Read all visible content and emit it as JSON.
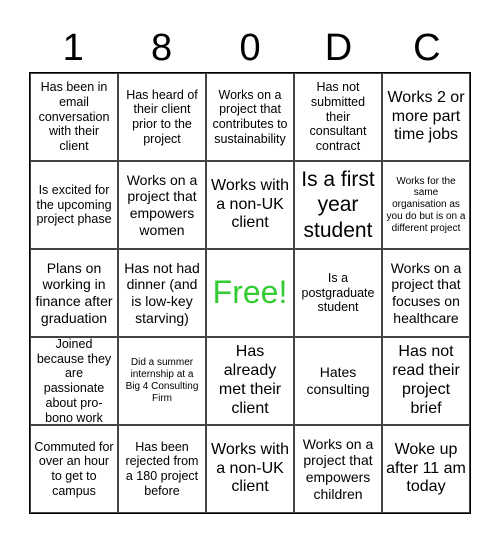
{
  "header": {
    "letters": [
      "1",
      "8",
      "0",
      "D",
      "C"
    ]
  },
  "colors": {
    "free_space": "#33cc33",
    "grid_line": "#444444",
    "text": "#000000"
  },
  "board": {
    "rows": [
      [
        {
          "text": "Has been in email conversation with their client",
          "size": "s"
        },
        {
          "text": "Has heard of their client prior to the project",
          "size": "s"
        },
        {
          "text": "Works on a project that contributes to sustainability",
          "size": "s"
        },
        {
          "text": "Has not submitted their consultant contract",
          "size": "s"
        },
        {
          "text": "Works 2 or more part time jobs",
          "size": "l"
        }
      ],
      [
        {
          "text": "Is excited for the upcoming project phase",
          "size": "s"
        },
        {
          "text": "Works on a project that empowers women",
          "size": "m"
        },
        {
          "text": "Works with a non-UK client",
          "size": "l"
        },
        {
          "text": "Is a first year student",
          "size": "xl"
        },
        {
          "text": "Works for the same organisation as you do but is on a different project",
          "size": "xs"
        }
      ],
      [
        {
          "text": "Plans on working in finance after graduation",
          "size": "m"
        },
        {
          "text": "Has not had dinner (and is low-key starving)",
          "size": "m"
        },
        {
          "text": "Free!",
          "size": "free"
        },
        {
          "text": "Is a postgraduate student",
          "size": "s"
        },
        {
          "text": "Works on a project that focuses on healthcare",
          "size": "m"
        }
      ],
      [
        {
          "text": "Joined because they are passionate about pro-bono work",
          "size": "s"
        },
        {
          "text": "Did a summer internship at a Big 4 Consulting Firm",
          "size": "xs"
        },
        {
          "text": "Has already met their client",
          "size": "l"
        },
        {
          "text": "Hates consulting",
          "size": "m"
        },
        {
          "text": "Has not read their project brief",
          "size": "l"
        }
      ],
      [
        {
          "text": "Commuted for over an hour to get to campus",
          "size": "s"
        },
        {
          "text": "Has been rejected from a 180 project before",
          "size": "s"
        },
        {
          "text": "Works with a non-UK client",
          "size": "l"
        },
        {
          "text": "Works on a project that empowers children",
          "size": "m"
        },
        {
          "text": "Woke up after 11 am today",
          "size": "l"
        }
      ]
    ]
  }
}
